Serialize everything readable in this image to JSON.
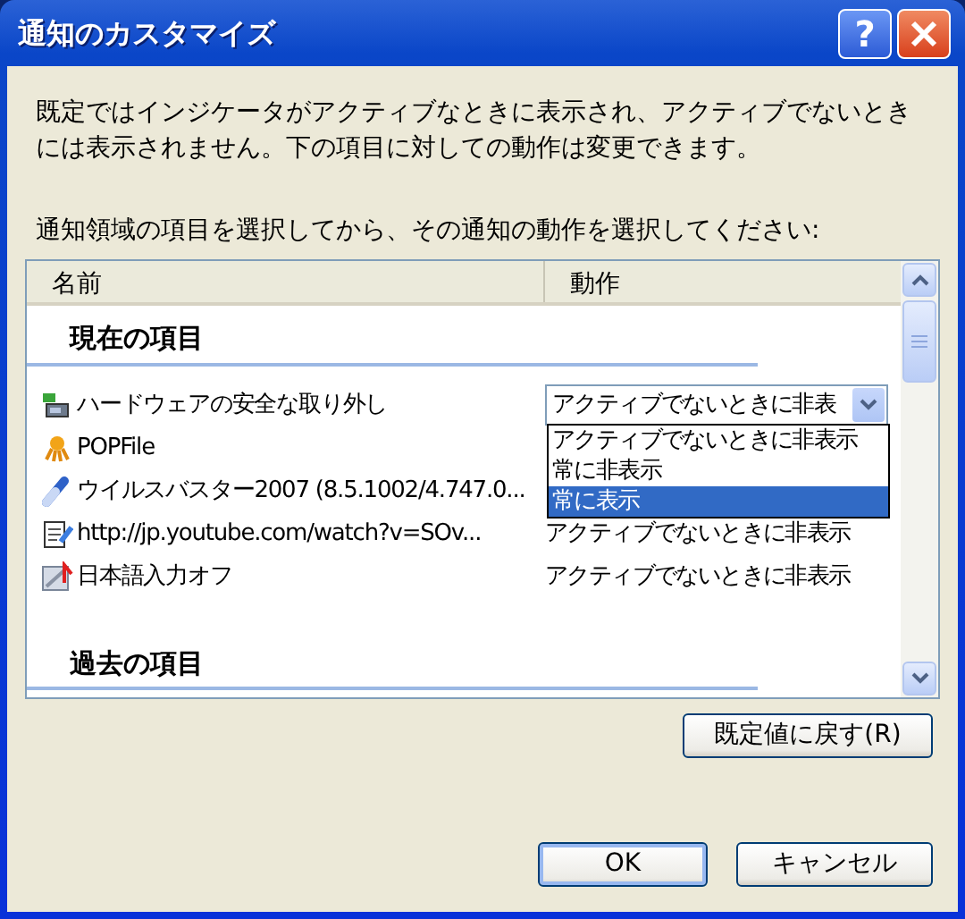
{
  "window": {
    "title": "通知のカスタマイズ",
    "help_button": "?"
  },
  "description": "既定ではインジケータがアクティブなときに表示され、アクティブでないときには表示されません。下の項目に対しての動作は変更できます。",
  "instruction": "通知領域の項目を選択してから、その通知の動作を選択してください:",
  "columns": [
    "名前",
    "動作"
  ],
  "sections": [
    {
      "title": "現在の項目",
      "items": [
        {
          "name": "ハードウェアの安全な取り外し",
          "kind": "combo",
          "action": "アクティブでないときに非表",
          "expanded": true,
          "options": [
            {
              "label": "アクティブでないときに非表示",
              "selected": false
            },
            {
              "label": "常に非表示",
              "selected": false
            },
            {
              "label": "常に表示",
              "selected": true
            }
          ]
        },
        {
          "name": "POPFile",
          "kind": "plain"
        },
        {
          "name": "ウイルスバスター2007 (8.5.1002/4.747.0...",
          "kind": "plain"
        },
        {
          "name": "http://jp.youtube.com/watch?v=SOv...",
          "kind": "plain",
          "action": "アクティブでないときに非表示"
        },
        {
          "name": "日本語入力オフ",
          "kind": "plain",
          "action": "アクティブでないときに非表示"
        }
      ]
    },
    {
      "title": "過去の項目"
    }
  ],
  "buttons": {
    "reset": "既定値に戻す(R)",
    "ok": "OK",
    "cancel": "キャンセル"
  }
}
